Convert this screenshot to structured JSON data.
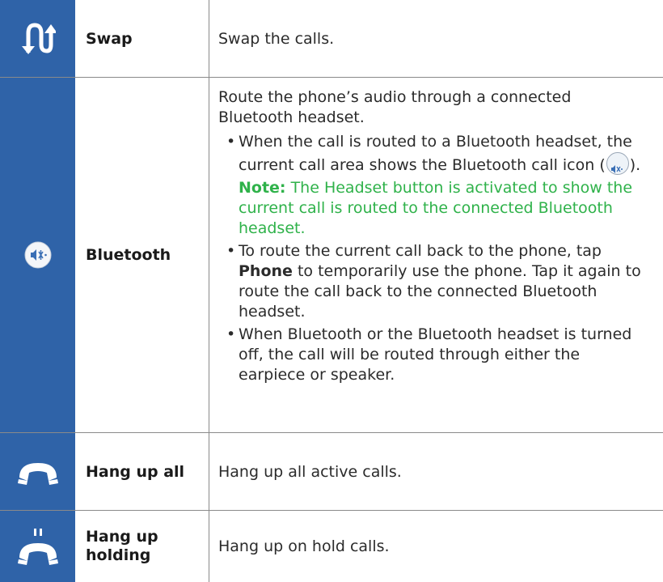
{
  "rows": [
    {
      "name": "Swap",
      "icon": "swap-arrows-icon",
      "desc": "Swap the calls."
    },
    {
      "name": "Bluetooth",
      "icon": "bluetooth-audio-icon",
      "intro": "Route the phone’s audio through a connected Bluetooth headset.",
      "b1_pre": "When the call is routed to a Bluetooth headset, the current call area shows the Bluetooth call icon (",
      "b1_post": ").",
      "note_label": "Note:",
      "note_text": "The Headset button is activated to show the current call is routed to the connected Bluetooth headset.",
      "b2_pre": "To route the current call back to the phone, tap ",
      "b2_bold": "Phone",
      "b2_post": " to temporarily use the phone. Tap it again to route the call back to the connected Bluetooth headset.",
      "b3": "When Bluetooth or the Bluetooth headset is turned off, the call will be routed through either the earpiece or speaker."
    },
    {
      "name": "Hang up all",
      "icon": "hang-up-icon",
      "desc": "Hang up all active calls."
    },
    {
      "name": "Hang up holding",
      "icon": "hang-up-holding-icon",
      "desc": "Hang up on hold calls."
    }
  ],
  "colors": {
    "icon_column": "#2f63a8",
    "note": "#2fb24a"
  }
}
